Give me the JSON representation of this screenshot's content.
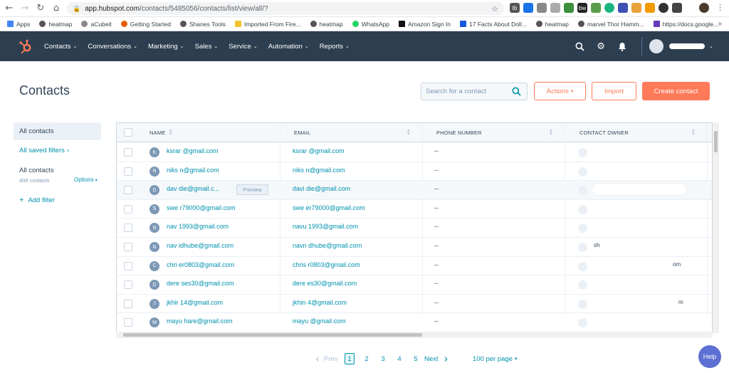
{
  "browser": {
    "url_host": "app.hubspot.com",
    "url_path": "/contacts/5485056/contacts/list/view/all/?",
    "bookmarks": [
      "Apps",
      "heatmap",
      "aCubeit",
      "Getting Started",
      "Shanes Tools",
      "Imported From Fire...",
      "heatmap",
      "WhatsApp",
      "Amazon Sign In",
      "17 Facts About Doll...",
      "heatmap",
      "marvel Thor Hamm...",
      "https://docs.google..."
    ],
    "bookmarks_more": "»"
  },
  "nav": {
    "items": [
      "Contacts",
      "Conversations",
      "Marketing",
      "Sales",
      "Service",
      "Automation",
      "Reports"
    ]
  },
  "header": {
    "title": "Contacts",
    "search_placeholder": "Search for a contact",
    "actions_label": "Actions",
    "import_label": "Import",
    "create_label": "Create contact"
  },
  "sidebar": {
    "active": "All contacts",
    "saved_filters": "All saved filters",
    "list_name": "All contacts",
    "list_count": "406 contacts",
    "options": "Options",
    "add_filter": "Add filter"
  },
  "table": {
    "columns": [
      "NAME",
      "EMAIL",
      "PHONE NUMBER",
      "CONTACT OWNER"
    ],
    "preview_label": "Preview",
    "rows": [
      {
        "initial": "K",
        "name": "ksrar @gmail.com",
        "email": "ksrar @gmail.com",
        "phone": "--",
        "owner": ""
      },
      {
        "initial": "N",
        "name": "niks n@gmail.com",
        "email": "niks n@gmail.com",
        "phone": "--",
        "owner": ""
      },
      {
        "initial": "D",
        "name": "dav die@gmail.c...",
        "email": "davi die@gmail.com",
        "phone": "--",
        "owner": ""
      },
      {
        "initial": "S",
        "name": "swe r79000@gmail.com",
        "email": "swe er79000@gmail.com",
        "phone": "--",
        "owner": ""
      },
      {
        "initial": "N",
        "name": "nav 1993@gmail.com",
        "email": "navu 1993@gmail.com",
        "phone": "--",
        "owner": ""
      },
      {
        "initial": "N",
        "name": "nav idhube@gmail.com",
        "email": "navn dhube@gmail.com",
        "phone": "--",
        "owner": "sh"
      },
      {
        "initial": "C",
        "name": "chri er0803@gmail.com",
        "email": "chris r0803@gmail.com",
        "phone": "--",
        "owner": "om"
      },
      {
        "initial": "D",
        "name": "dere ses30@gmail.com",
        "email": "dere es30@gmail.com",
        "phone": "--",
        "owner": ""
      },
      {
        "initial": "J",
        "name": "jkhir 14@gmail.com",
        "email": "jkhin 4@gmail.com",
        "phone": "--",
        "owner": "m"
      },
      {
        "initial": "M",
        "name": "mayu hare@gmail.com",
        "email": "mayu @gmail.com",
        "phone": "--",
        "owner": ""
      }
    ]
  },
  "pagination": {
    "prev": "Prev",
    "pages": [
      "1",
      "2",
      "3",
      "4",
      "5"
    ],
    "current": "1",
    "next": "Next",
    "per_page": "100 per page"
  },
  "help_label": "Help",
  "colors": {
    "nav_bg": "#2d3e50",
    "accent": "#ff7a59",
    "link": "#0091ae"
  }
}
